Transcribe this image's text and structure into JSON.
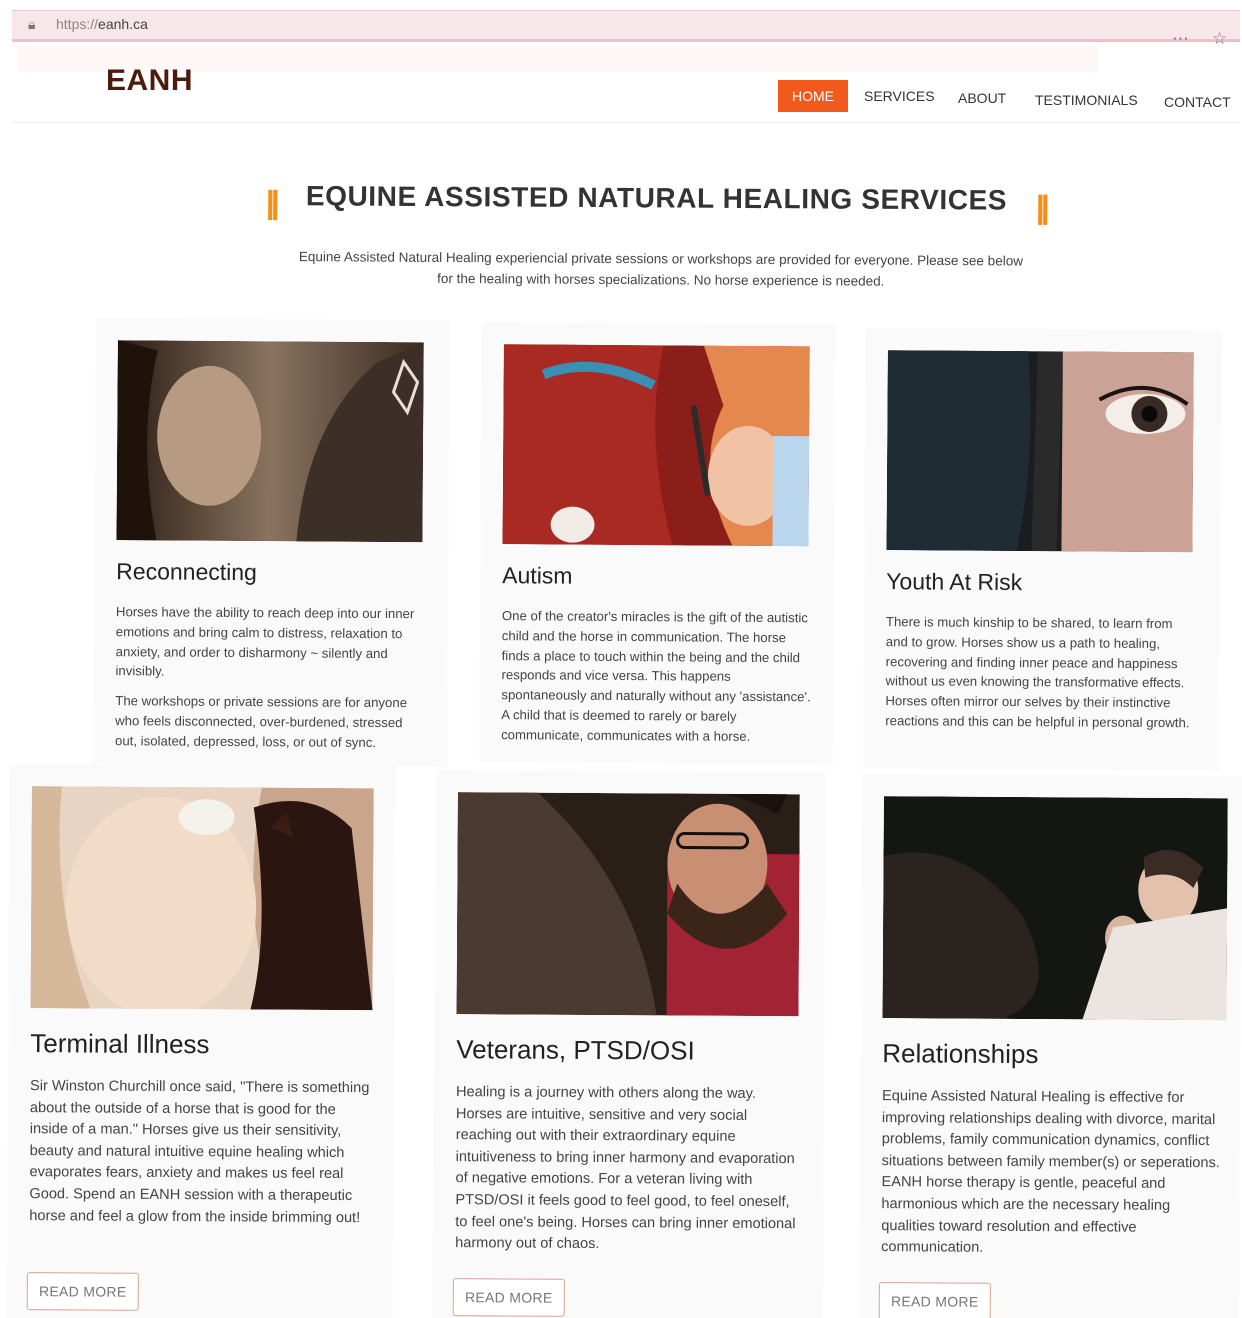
{
  "browser": {
    "url_scheme": "https://",
    "url_host": "eanh.ca"
  },
  "header": {
    "logo": "EANH",
    "nav": [
      {
        "label": "HOME",
        "active": true
      },
      {
        "label": "SERVICES"
      },
      {
        "label": "ABOUT"
      },
      {
        "label": "TESTIMONIALS"
      },
      {
        "label": "CONTACT"
      }
    ]
  },
  "section": {
    "title": "EQUINE ASSISTED NATURAL HEALING SERVICES",
    "title_bar": "||",
    "intro_line1": "Equine Assisted Natural Healing experiencial private sessions or workshops are provided for everyone. Please see below",
    "intro_line2": "for the healing with horses specializations. No horse experience is needed."
  },
  "cards": [
    {
      "title": "Reconnecting",
      "paragraphs": [
        "Horses have the ability to reach deep into our inner emotions and bring calm to distress, relaxation to anxiety, and order to disharmony ~ silently and invisibly.",
        "The workshops or private sessions are for anyone who feels disconnected, over-burdened, stressed out, isolated, depressed, loss, or out of sync."
      ]
    },
    {
      "title": "Autism",
      "paragraphs": [
        "One of the creator's miracles is the gift of the autistic child and the horse in communication. The horse finds a place to touch within the being and the child responds and vice versa. This happens spontaneously and naturally without any 'assistance'. A child that is deemed to rarely or barely communicate, communicates with a horse."
      ]
    },
    {
      "title": "Youth At Risk",
      "paragraphs": [
        "There is much kinship to be shared, to learn from and to grow. Horses show us a path to healing, recovering and finding inner peace and happiness without us even knowing the transformative effects. Horses often mirror our selves by their instinctive reactions and this can be helpful in personal growth."
      ]
    },
    {
      "title": "Terminal Illness",
      "paragraphs": [
        "Sir Winston Churchill once said, \"There is something about the outside of a horse that is good for the inside of a man.\" Horses give us their sensitivity, beauty and natural intuitive equine healing which evaporates fears, anxiety and makes us feel real Good. Spend an EANH session with a therapeutic horse and feel a glow from the inside brimming out!"
      ],
      "button": "READ MORE"
    },
    {
      "title": "Veterans, PTSD/OSI",
      "paragraphs": [
        "Healing is a journey with others along the way. Horses are intuitive, sensitive and very social reaching out with their extraordinary equine intuitiveness to bring inner harmony and evaporation of negative emotions. For a veteran living with PTSD/OSI it feels good to feel good, to feel oneself, to feel one's being. Horses can bring inner emotional harmony out of chaos."
      ],
      "button": "READ MORE"
    },
    {
      "title": "Relationships",
      "paragraphs": [
        "Equine Assisted Natural Healing is effective for improving relationships dealing with divorce, marital problems, family communication dynamics, conflict situations between family member(s) or seperations. EANH horse therapy is gentle, peaceful and harmonious which are the necessary healing qualities toward resolution and effective communication."
      ],
      "button": "READ MORE"
    }
  ],
  "colors": {
    "accent": "#f15a1b",
    "title_bars": "#f39017",
    "logo": "#4b1b0c"
  }
}
